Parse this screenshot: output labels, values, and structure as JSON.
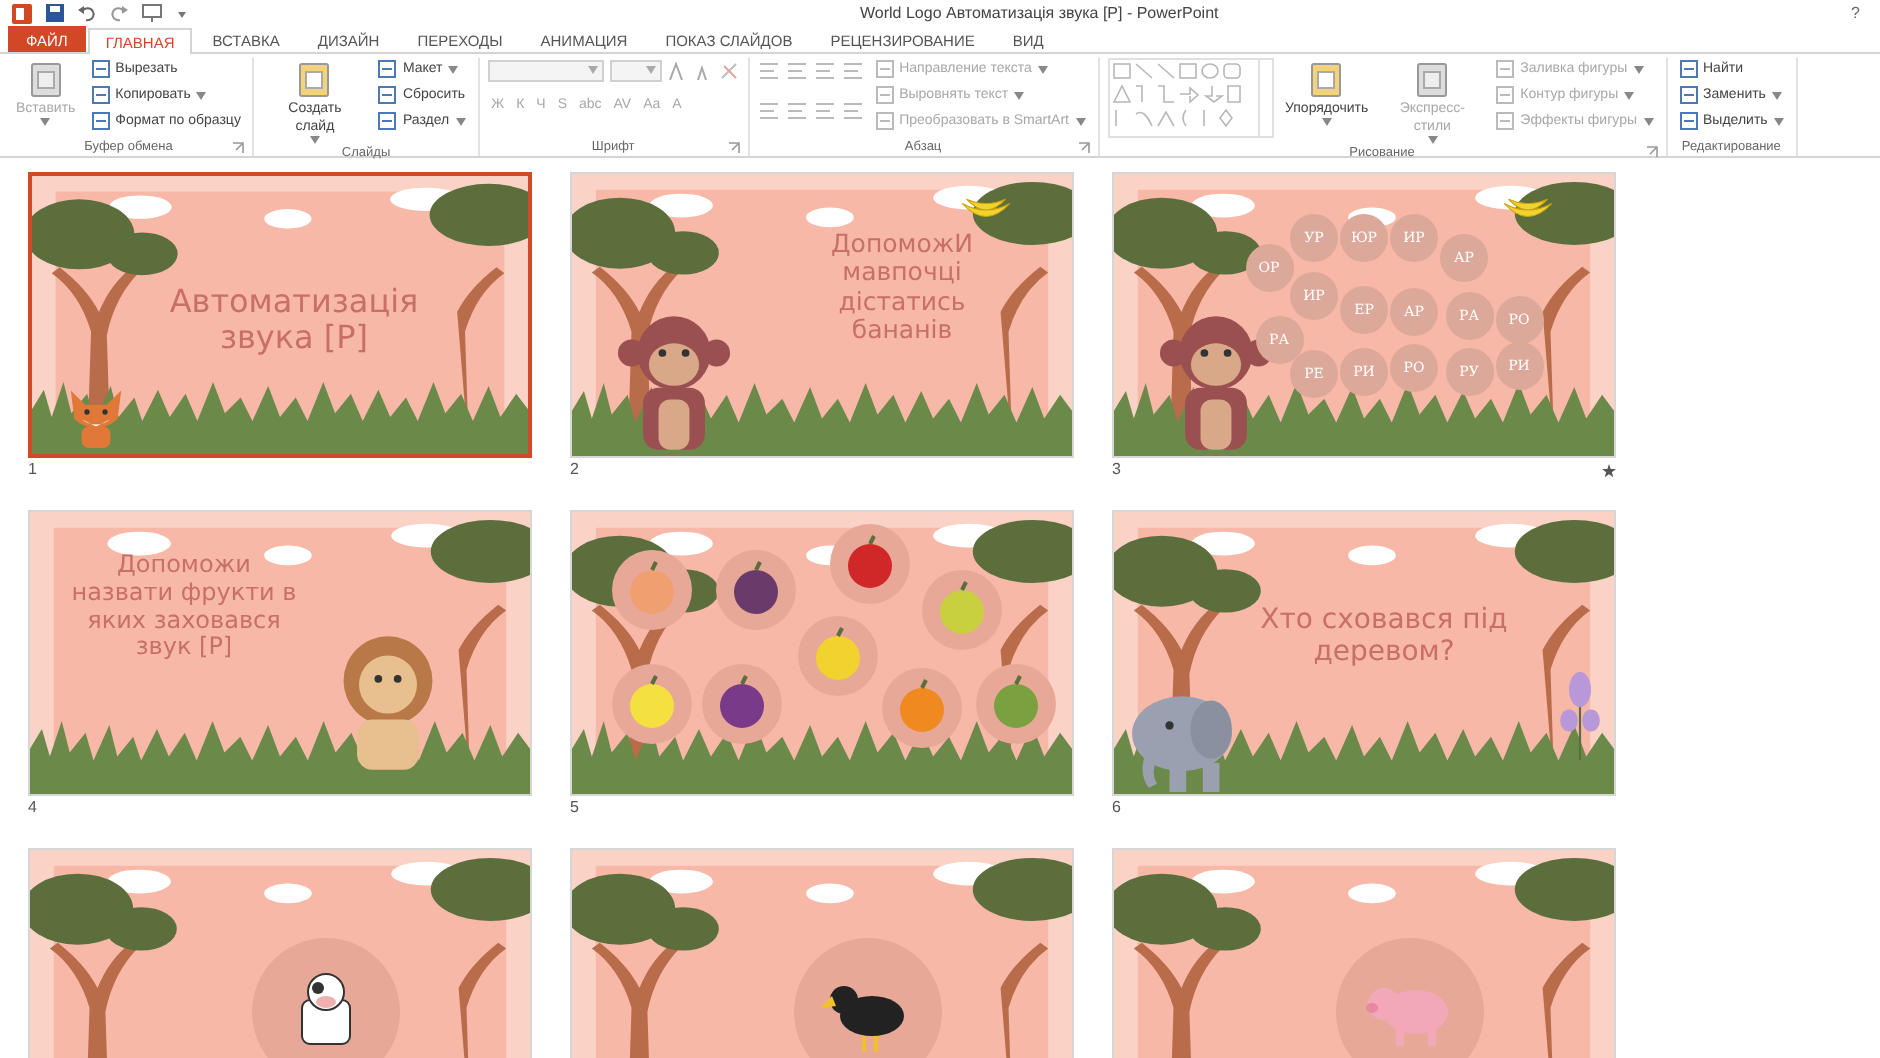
{
  "window": {
    "title": "World Logo Автоматизація звука [Р] - PowerPoint",
    "help": "?"
  },
  "tabs": [
    {
      "label": "ФАЙЛ",
      "kind": "file",
      "selected": false
    },
    {
      "label": "ГЛАВНАЯ",
      "kind": "tab",
      "selected": true
    },
    {
      "label": "ВСТАВКА",
      "kind": "tab",
      "selected": false
    },
    {
      "label": "ДИЗАЙН",
      "kind": "tab",
      "selected": false
    },
    {
      "label": "ПЕРЕХОДЫ",
      "kind": "tab",
      "selected": false
    },
    {
      "label": "АНИМАЦИЯ",
      "kind": "tab",
      "selected": false
    },
    {
      "label": "ПОКАЗ СЛАЙДОВ",
      "kind": "tab",
      "selected": false
    },
    {
      "label": "РЕЦЕНЗИРОВАНИЕ",
      "kind": "tab",
      "selected": false
    },
    {
      "label": "ВИД",
      "kind": "tab",
      "selected": false
    }
  ],
  "ribbon_groups": [
    {
      "title": "Буфер обмена",
      "launcher": true,
      "columns": [
        [
          {
            "kind": "large",
            "label": "Вставить",
            "caret": true,
            "disabled": true
          }
        ],
        [
          {
            "kind": "small",
            "label": "Вырезать",
            "caret": false,
            "disabled": false
          },
          {
            "kind": "small",
            "label": "Копировать",
            "caret": true,
            "disabled": false
          },
          {
            "kind": "small",
            "label": "Формат по образцу",
            "caret": false,
            "disabled": false
          }
        ]
      ]
    },
    {
      "title": "Слайды",
      "launcher": false,
      "columns": [
        [
          {
            "kind": "large",
            "label": "Создать слайд",
            "caret": true,
            "disabled": false
          }
        ],
        [
          {
            "kind": "small",
            "label": "Макет",
            "caret": true,
            "disabled": false
          },
          {
            "kind": "small",
            "label": "Сбросить",
            "caret": false,
            "disabled": false
          },
          {
            "kind": "small",
            "label": "Раздел",
            "caret": true,
            "disabled": false
          }
        ]
      ]
    },
    {
      "title": "Шрифт",
      "launcher": true,
      "columns": [
        [
          {
            "kind": "field-row",
            "disabled": true
          },
          {
            "kind": "glyph-row",
            "glyphs": [
              "Ж",
              "К",
              "Ч",
              "S",
              "abc",
              "AV",
              "Aa",
              "A"
            ],
            "disabled": true
          }
        ]
      ]
    },
    {
      "title": "Абзац",
      "launcher": true,
      "columns": [
        [
          {
            "kind": "icon-row",
            "disabled": true
          },
          {
            "kind": "icon-row",
            "disabled": true
          }
        ],
        [
          {
            "kind": "small",
            "label": "Направление текста",
            "caret": true,
            "disabled": true
          },
          {
            "kind": "small",
            "label": "Выровнять текст",
            "caret": true,
            "disabled": true
          },
          {
            "kind": "small",
            "label": "Преобразовать в SmartArt",
            "caret": true,
            "disabled": true
          }
        ]
      ]
    },
    {
      "title": "Рисование",
      "launcher": true,
      "columns": [
        [
          {
            "kind": "gallery",
            "disabled": true
          }
        ],
        [
          {
            "kind": "large",
            "label": "Упорядочить",
            "caret": true,
            "disabled": false
          }
        ],
        [
          {
            "kind": "large",
            "label": "Экспресс-стили",
            "caret": true,
            "disabled": true
          }
        ],
        [
          {
            "kind": "small",
            "label": "Заливка фигуры",
            "caret": true,
            "disabled": true
          },
          {
            "kind": "small",
            "label": "Контур фигуры",
            "caret": true,
            "disabled": true
          },
          {
            "kind": "small",
            "label": "Эффекты фигуры",
            "caret": true,
            "disabled": true
          }
        ]
      ]
    },
    {
      "title": "Редактирование",
      "launcher": false,
      "columns": [
        [
          {
            "kind": "small",
            "label": "Найти",
            "caret": false,
            "disabled": false
          },
          {
            "kind": "small",
            "label": "Заменить",
            "caret": true,
            "disabled": false
          },
          {
            "kind": "small",
            "label": "Выделить",
            "caret": true,
            "disabled": false
          }
        ]
      ]
    }
  ],
  "slides": [
    {
      "number": "1",
      "selected": true,
      "animated": false,
      "kind": "fox",
      "title": "Автоматизація звука [Р]"
    },
    {
      "number": "2",
      "selected": false,
      "animated": false,
      "kind": "monkey",
      "title": "ДопоможИ мавпочці дістатись бананів"
    },
    {
      "number": "3",
      "selected": false,
      "animated": true,
      "kind": "syllables",
      "syllables": [
        "ОР",
        "УР",
        "ЮР",
        "ИР",
        "АР",
        "ИР",
        "ЕР",
        "АР",
        "РА",
        "РО",
        "РА",
        "РЕ",
        "РИ",
        "РО",
        "РУ",
        "РИ"
      ]
    },
    {
      "number": "4",
      "selected": false,
      "animated": false,
      "kind": "lion",
      "title": "Допоможи назвати фрукти в яких заховався звук [Р]"
    },
    {
      "number": "5",
      "selected": false,
      "animated": false,
      "kind": "fruits"
    },
    {
      "number": "6",
      "selected": false,
      "animated": false,
      "kind": "elephant",
      "title": "Хто сховався під деревом?"
    },
    {
      "selected": false,
      "animated": false,
      "kind": "cow"
    },
    {
      "selected": false,
      "animated": false,
      "kind": "crow"
    },
    {
      "selected": false,
      "animated": false,
      "kind": "pig"
    }
  ]
}
